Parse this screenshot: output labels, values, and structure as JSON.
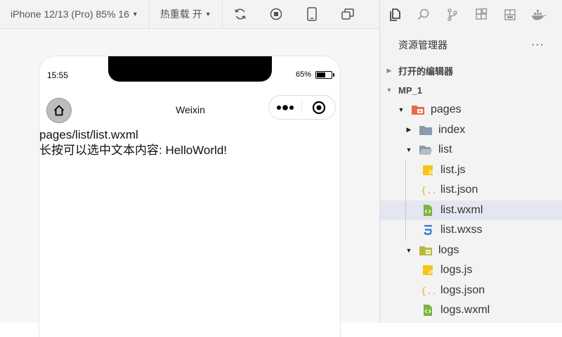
{
  "toolbar": {
    "device_select": "iPhone 12/13 (Pro) 85% 16",
    "hotreload_select": "热重载 开",
    "icons": [
      "compile-icon",
      "stop-icon",
      "phone-preview-icon",
      "window-icon"
    ]
  },
  "simulator": {
    "time": "15:55",
    "battery_percent": "65%",
    "battery_level": 0.65,
    "nav_title": "Weixin",
    "page_path": "pages/list/list.wxml",
    "page_text": "长按可以选中文本内容: HelloWorld!"
  },
  "activity_bar": {
    "icons": [
      "explorer-icon",
      "search-icon",
      "source-control-icon",
      "extensions-icon",
      "layout-icon",
      "docker-icon"
    ]
  },
  "explorer": {
    "title": "资源管理器",
    "more": "···",
    "open_editors": "打开的编辑器",
    "project": "MP_1",
    "tree": [
      {
        "label": "pages",
        "icon": "pages-folder-icon",
        "indent": 0,
        "twisty": "▼"
      },
      {
        "label": "index",
        "icon": "folder-icon",
        "indent": 1,
        "twisty": "▶"
      },
      {
        "label": "list",
        "icon": "folder-open-icon",
        "indent": 1,
        "twisty": "▼"
      },
      {
        "label": "list.js",
        "icon": "js-file-icon",
        "indent": 2,
        "twisty": ""
      },
      {
        "label": "list.json",
        "icon": "json-file-icon",
        "indent": 2,
        "twisty": ""
      },
      {
        "label": "list.wxml",
        "icon": "wxml-file-icon",
        "indent": 2,
        "twisty": "",
        "selected": true
      },
      {
        "label": "list.wxss",
        "icon": "wxss-file-icon",
        "indent": 2,
        "twisty": ""
      },
      {
        "label": "logs",
        "icon": "logs-folder-icon",
        "indent": 1,
        "twisty": "▼"
      },
      {
        "label": "logs.js",
        "icon": "js-file-icon",
        "indent": 2,
        "twisty": ""
      },
      {
        "label": "logs.json",
        "icon": "json-file-icon",
        "indent": 2,
        "twisty": ""
      },
      {
        "label": "logs.wxml",
        "icon": "wxml-file-icon",
        "indent": 2,
        "twisty": ""
      }
    ]
  },
  "colors": {
    "js": "#f5c518",
    "json": "#e6b422",
    "wxml": "#7cb342",
    "wxss": "#2979d8",
    "folder": "#8a9aa8",
    "pages_folder": "#e8684a",
    "logs_folder": "#b8b83c",
    "selected_row": "#e4e6f1"
  }
}
